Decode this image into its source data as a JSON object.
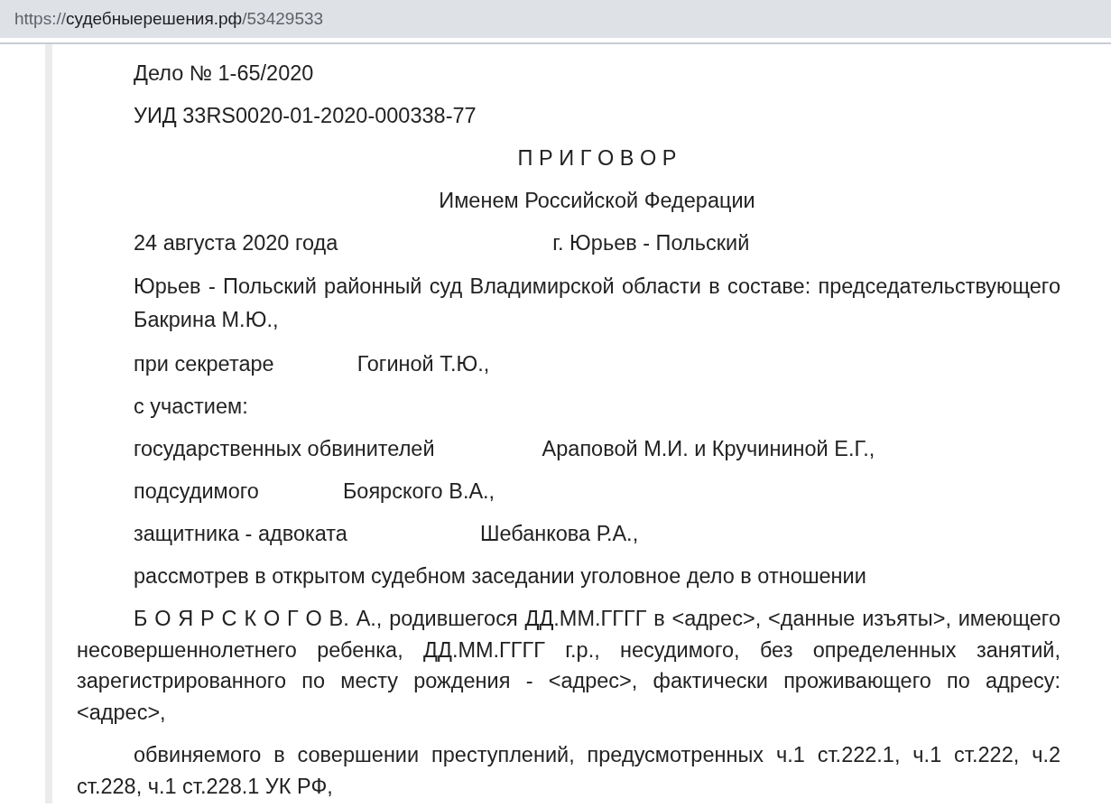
{
  "address_bar": {
    "scheme": "https://",
    "host": "судебныерешения.рф",
    "path": "/53429533"
  },
  "document": [
    {
      "kind": "line",
      "text": "Дело № 1-65/2020"
    },
    {
      "kind": "line",
      "text": "УИД 33RS0020-01-2020-000338-77"
    },
    {
      "kind": "center",
      "text": "П Р И Г О В О Р"
    },
    {
      "kind": "center",
      "text": "Именем Российской Федерации"
    },
    {
      "kind": "split",
      "parts": [
        "24 августа 2020 года",
        "г. Юрьев - Польский"
      ]
    },
    {
      "kind": "block",
      "text": "Юрьев - Польский районный суд Владимирской области в составе: председательствующего  Бакрина М.Ю.,"
    },
    {
      "kind": "split",
      "parts": [
        "при секретаре",
        "Гогиной Т.Ю.,"
      ]
    },
    {
      "kind": "line",
      "text": "с участием:"
    },
    {
      "kind": "split",
      "parts": [
        "государственных обвинителей",
        "Араповой М.И. и Кручининой Е.Г.,"
      ]
    },
    {
      "kind": "split",
      "parts": [
        "подсудимого",
        "Боярского В.А.,"
      ]
    },
    {
      "kind": "split",
      "parts": [
        "защитника - адвоката",
        "Шебанкова Р.А.,"
      ]
    },
    {
      "kind": "line",
      "text": "рассмотрев в открытом судебном заседании уголовное дело в отношении"
    },
    {
      "kind": "para",
      "text": "Б О Я Р С К О Г О В. А., родившегося ДД.ММ.ГГГГ в <адрес>, <данные изъяты>, имеющего несовершеннолетнего ребенка, ДД.ММ.ГГГГ г.р., несудимого, без определенных занятий, зарегистрированного по месту рождения - <адрес>, фактически проживающего по адресу: <адрес>,"
    },
    {
      "kind": "para",
      "text": "обвиняемого в совершении преступлений, предусмотренных ч.1 ст.222.1, ч.1 ст.222, ч.2 ст.228, ч.1 ст.228.1 УК РФ,"
    }
  ]
}
